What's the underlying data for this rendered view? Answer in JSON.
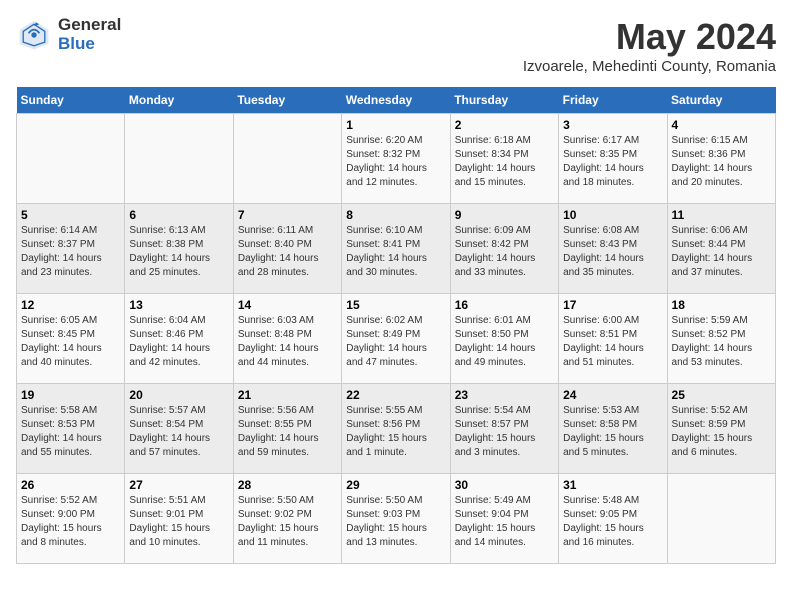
{
  "header": {
    "logo_general": "General",
    "logo_blue": "Blue",
    "title": "May 2024",
    "subtitle": "Izvoarele, Mehedinti County, Romania"
  },
  "days_of_week": [
    "Sunday",
    "Monday",
    "Tuesday",
    "Wednesday",
    "Thursday",
    "Friday",
    "Saturday"
  ],
  "weeks": [
    [
      {
        "day": "",
        "info": ""
      },
      {
        "day": "",
        "info": ""
      },
      {
        "day": "",
        "info": ""
      },
      {
        "day": "1",
        "info": "Sunrise: 6:20 AM\nSunset: 8:32 PM\nDaylight: 14 hours\nand 12 minutes."
      },
      {
        "day": "2",
        "info": "Sunrise: 6:18 AM\nSunset: 8:34 PM\nDaylight: 14 hours\nand 15 minutes."
      },
      {
        "day": "3",
        "info": "Sunrise: 6:17 AM\nSunset: 8:35 PM\nDaylight: 14 hours\nand 18 minutes."
      },
      {
        "day": "4",
        "info": "Sunrise: 6:15 AM\nSunset: 8:36 PM\nDaylight: 14 hours\nand 20 minutes."
      }
    ],
    [
      {
        "day": "5",
        "info": "Sunrise: 6:14 AM\nSunset: 8:37 PM\nDaylight: 14 hours\nand 23 minutes."
      },
      {
        "day": "6",
        "info": "Sunrise: 6:13 AM\nSunset: 8:38 PM\nDaylight: 14 hours\nand 25 minutes."
      },
      {
        "day": "7",
        "info": "Sunrise: 6:11 AM\nSunset: 8:40 PM\nDaylight: 14 hours\nand 28 minutes."
      },
      {
        "day": "8",
        "info": "Sunrise: 6:10 AM\nSunset: 8:41 PM\nDaylight: 14 hours\nand 30 minutes."
      },
      {
        "day": "9",
        "info": "Sunrise: 6:09 AM\nSunset: 8:42 PM\nDaylight: 14 hours\nand 33 minutes."
      },
      {
        "day": "10",
        "info": "Sunrise: 6:08 AM\nSunset: 8:43 PM\nDaylight: 14 hours\nand 35 minutes."
      },
      {
        "day": "11",
        "info": "Sunrise: 6:06 AM\nSunset: 8:44 PM\nDaylight: 14 hours\nand 37 minutes."
      }
    ],
    [
      {
        "day": "12",
        "info": "Sunrise: 6:05 AM\nSunset: 8:45 PM\nDaylight: 14 hours\nand 40 minutes."
      },
      {
        "day": "13",
        "info": "Sunrise: 6:04 AM\nSunset: 8:46 PM\nDaylight: 14 hours\nand 42 minutes."
      },
      {
        "day": "14",
        "info": "Sunrise: 6:03 AM\nSunset: 8:48 PM\nDaylight: 14 hours\nand 44 minutes."
      },
      {
        "day": "15",
        "info": "Sunrise: 6:02 AM\nSunset: 8:49 PM\nDaylight: 14 hours\nand 47 minutes."
      },
      {
        "day": "16",
        "info": "Sunrise: 6:01 AM\nSunset: 8:50 PM\nDaylight: 14 hours\nand 49 minutes."
      },
      {
        "day": "17",
        "info": "Sunrise: 6:00 AM\nSunset: 8:51 PM\nDaylight: 14 hours\nand 51 minutes."
      },
      {
        "day": "18",
        "info": "Sunrise: 5:59 AM\nSunset: 8:52 PM\nDaylight: 14 hours\nand 53 minutes."
      }
    ],
    [
      {
        "day": "19",
        "info": "Sunrise: 5:58 AM\nSunset: 8:53 PM\nDaylight: 14 hours\nand 55 minutes."
      },
      {
        "day": "20",
        "info": "Sunrise: 5:57 AM\nSunset: 8:54 PM\nDaylight: 14 hours\nand 57 minutes."
      },
      {
        "day": "21",
        "info": "Sunrise: 5:56 AM\nSunset: 8:55 PM\nDaylight: 14 hours\nand 59 minutes."
      },
      {
        "day": "22",
        "info": "Sunrise: 5:55 AM\nSunset: 8:56 PM\nDaylight: 15 hours\nand 1 minute."
      },
      {
        "day": "23",
        "info": "Sunrise: 5:54 AM\nSunset: 8:57 PM\nDaylight: 15 hours\nand 3 minutes."
      },
      {
        "day": "24",
        "info": "Sunrise: 5:53 AM\nSunset: 8:58 PM\nDaylight: 15 hours\nand 5 minutes."
      },
      {
        "day": "25",
        "info": "Sunrise: 5:52 AM\nSunset: 8:59 PM\nDaylight: 15 hours\nand 6 minutes."
      }
    ],
    [
      {
        "day": "26",
        "info": "Sunrise: 5:52 AM\nSunset: 9:00 PM\nDaylight: 15 hours\nand 8 minutes."
      },
      {
        "day": "27",
        "info": "Sunrise: 5:51 AM\nSunset: 9:01 PM\nDaylight: 15 hours\nand 10 minutes."
      },
      {
        "day": "28",
        "info": "Sunrise: 5:50 AM\nSunset: 9:02 PM\nDaylight: 15 hours\nand 11 minutes."
      },
      {
        "day": "29",
        "info": "Sunrise: 5:50 AM\nSunset: 9:03 PM\nDaylight: 15 hours\nand 13 minutes."
      },
      {
        "day": "30",
        "info": "Sunrise: 5:49 AM\nSunset: 9:04 PM\nDaylight: 15 hours\nand 14 minutes."
      },
      {
        "day": "31",
        "info": "Sunrise: 5:48 AM\nSunset: 9:05 PM\nDaylight: 15 hours\nand 16 minutes."
      },
      {
        "day": "",
        "info": ""
      }
    ]
  ]
}
